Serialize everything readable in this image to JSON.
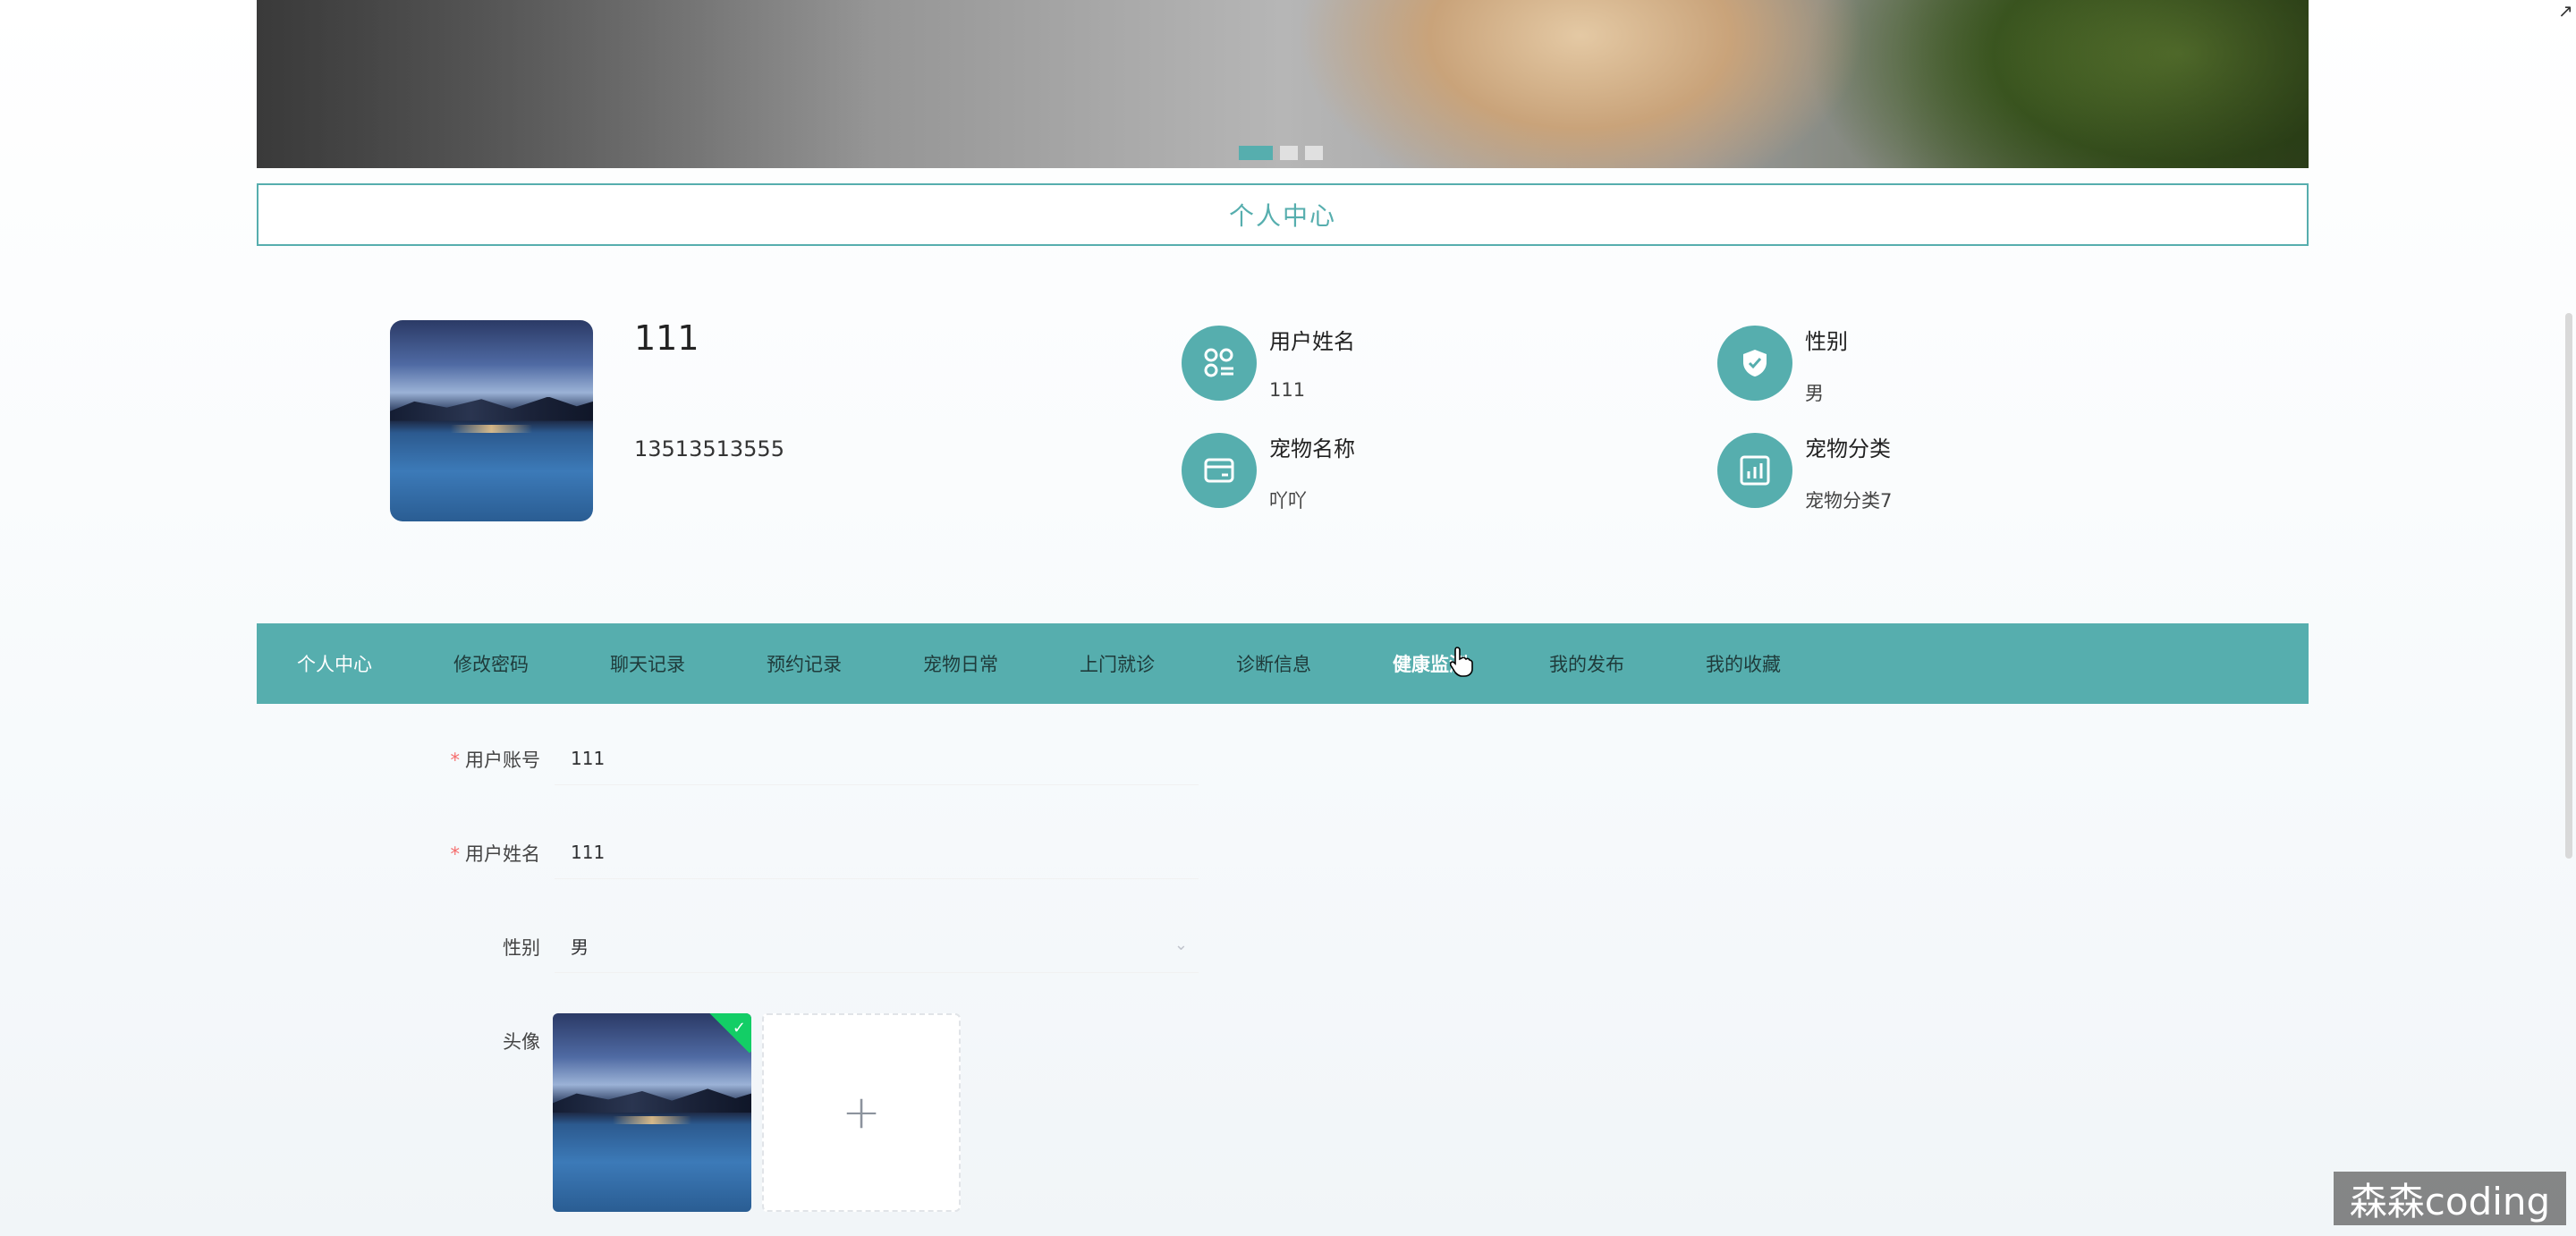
{
  "banner": {
    "dots": 3,
    "active_dot": 0
  },
  "section": {
    "title": "个人中心"
  },
  "profile": {
    "name": "111",
    "phone": "13513513555",
    "info": [
      {
        "label": "用户姓名",
        "value": "111",
        "icon": "user-card-icon"
      },
      {
        "label": "性别",
        "value": "男",
        "icon": "shield-check-icon"
      },
      {
        "label": "宠物名称",
        "value": "吖吖",
        "icon": "wallet-icon"
      },
      {
        "label": "宠物分类",
        "value": "宠物分类7",
        "icon": "chart-icon"
      }
    ]
  },
  "tabs": [
    "个人中心",
    "修改密码",
    "聊天记录",
    "预约记录",
    "宠物日常",
    "上门就诊",
    "诊断信息",
    "健康监测",
    "我的发布",
    "我的收藏"
  ],
  "form": {
    "account": {
      "label": "用户账号",
      "value": "111",
      "required": true
    },
    "name": {
      "label": "用户姓名",
      "value": "111",
      "required": true
    },
    "gender": {
      "label": "性别",
      "value": "男"
    },
    "avatar": {
      "label": "头像",
      "add_symbol": "+"
    }
  },
  "watermark": "森森coding",
  "colors": {
    "accent": "#56aeae",
    "required": "#f56c6c",
    "success": "#13ce66"
  }
}
